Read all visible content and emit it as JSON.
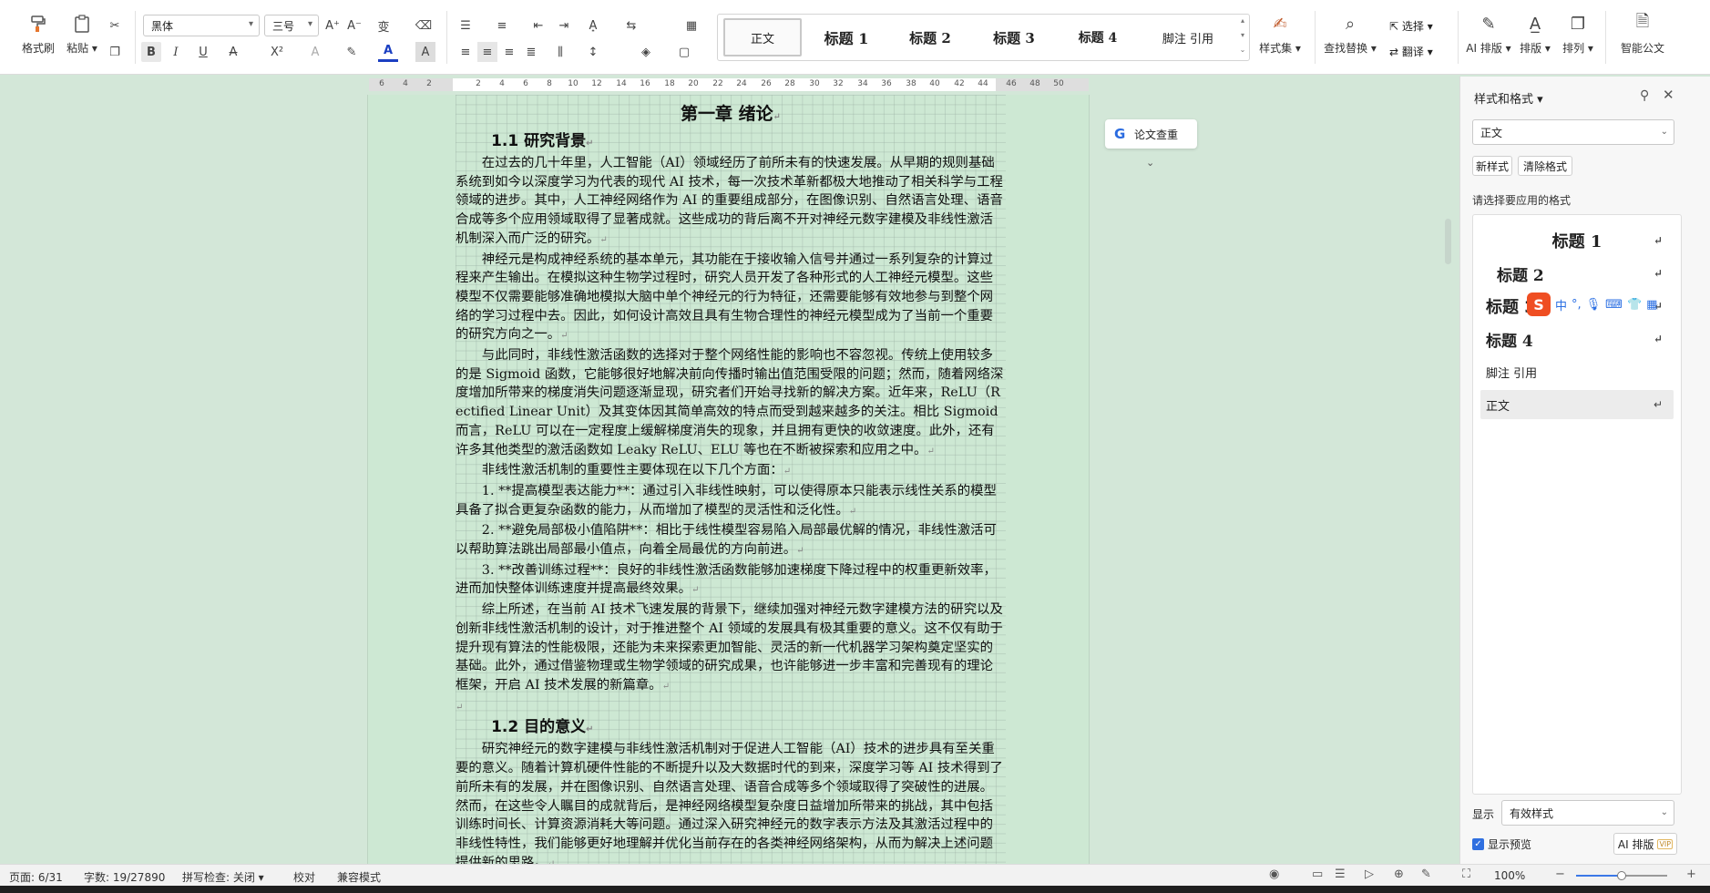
{
  "ribbon": {
    "format_painter": "格式刷",
    "paste": "粘贴",
    "font_name": "黑体",
    "font_size": "三号",
    "styles": [
      "正文",
      "标题 1",
      "标题 2",
      "标题 3",
      "标题 4",
      "脚注 引用"
    ],
    "style_set": "样式集",
    "find_replace": "查找替换",
    "select": "选择",
    "translate": "翻译",
    "ai_layout": "AI 排版",
    "layout": "排版",
    "arrange": "排列",
    "smart_formula": "智能公文"
  },
  "ruler": {
    "ticks": [
      "6",
      "4",
      "2",
      "2",
      "4",
      "6",
      "8",
      "10",
      "12",
      "14",
      "16",
      "18",
      "20",
      "22",
      "24",
      "26",
      "28",
      "30",
      "32",
      "34",
      "36",
      "38",
      "40",
      "42",
      "44",
      "46",
      "48",
      "50"
    ]
  },
  "document": {
    "chapter_title": "第一章 绪论",
    "section1_title": "1.1 研究背景",
    "section1_paragraphs": [
      "在过去的几十年里，人工智能（AI）领域经历了前所未有的快速发展。从早期的规则基础系统到如今以深度学习为代表的现代 AI 技术，每一次技术革新都极大地推动了相关科学与工程领域的进步。其中，人工神经网络作为 AI 的重要组成部分，在图像识别、自然语言处理、语音合成等多个应用领域取得了显著成就。这些成功的背后离不开对神经元数字建模及非线性激活机制深入而广泛的研究。",
      "神经元是构成神经系统的基本单元，其功能在于接收输入信号并通过一系列复杂的计算过程来产生输出。在模拟这种生物学过程时，研究人员开发了各种形式的人工神经元模型。这些模型不仅需要能够准确地模拟大脑中单个神经元的行为特征，还需要能够有效地参与到整个网络的学习过程中去。因此，如何设计高效且具有生物合理性的神经元模型成为了当前一个重要的研究方向之一。",
      "与此同时，非线性激活函数的选择对于整个网络性能的影响也不容忽视。传统上使用较多的是 Sigmoid 函数，它能够很好地解决前向传播时输出值范围受限的问题；然而，随着网络深度增加所带来的梯度消失问题逐渐显现，研究者们开始寻找新的解决方案。近年来，ReLU（Rectified Linear Unit）及其变体因其简单高效的特点而受到越来越多的关注。相比 Sigmoid 而言，ReLU 可以在一定程度上缓解梯度消失的现象，并且拥有更快的收敛速度。此外，还有许多其他类型的激活函数如 Leaky ReLU、ELU 等也在不断被探索和应用之中。",
      "非线性激活机制的重要性主要体现在以下几个方面：",
      "1. **提高模型表达能力**：通过引入非线性映射，可以使得原本只能表示线性关系的模型具备了拟合更复杂函数的能力，从而增加了模型的灵活性和泛化性。",
      "2. **避免局部极小值陷阱**：相比于线性模型容易陷入局部最优解的情况，非线性激活可以帮助算法跳出局部最小值点，向着全局最优的方向前进。",
      "3. **改善训练过程**：良好的非线性激活函数能够加速梯度下降过程中的权重更新效率，进而加快整体训练速度并提高最终效果。",
      "综上所述，在当前 AI 技术飞速发展的背景下，继续加强对神经元数字建模方法的研究以及创新非线性激活机制的设计，对于推进整个 AI 领域的发展具有极其重要的意义。这不仅有助于提升现有算法的性能极限，还能为未来探索更加智能、灵活的新一代机器学习架构奠定坚实的基础。此外，通过借鉴物理或生物学领域的研究成果，也许能够进一步丰富和完善现有的理论框架，开启 AI 技术发展的新篇章。"
    ],
    "section2_title": "1.2 目的意义",
    "section2_paragraphs": [
      "研究神经元的数字建模与非线性激活机制对于促进人工智能（AI）技术的进步具有至关重要的意义。随着计算机硬件性能的不断提升以及大数据时代的到来，深度学习等 AI 技术得到了前所未有的发展，并在图像识别、自然语言处理、语音合成等多个领域取得了突破性的进展。然而，在这些令人瞩目的成就背后，是神经网络模型复杂度日益增加所带来的挑战，其中包括训练时间长、计算资源消耗大等问题。通过深入研究神经元的数字表示方法及其激活过程中的非线性特性，我们能够更好地理解并优化当前存在的各类神经网络架构，从而为解决上述问题提供新的思路。"
    ]
  },
  "floating": {
    "paper_check": "论文查重"
  },
  "panel": {
    "title": "样式和格式",
    "current_style": "正文",
    "new_style_button": "新样式",
    "clear_format_button": "清除格式",
    "apply_label": "请选择要应用的格式",
    "styles": [
      "标题 1",
      "标题 2",
      "标题 3",
      "标题 4",
      "脚注 引用",
      "正文"
    ],
    "display_label": "显示",
    "display_value": "有效样式",
    "preview_label": "显示预览",
    "ai_layout_button": "AI 排版",
    "vip_badge": "VIP",
    "ime_lang": "中"
  },
  "status": {
    "page": "页面: 6/31",
    "words": "字数: 19/27890",
    "spell_check": "拼写检查: 关闭",
    "proofread": "校对",
    "compat_mode": "兼容模式",
    "zoom": "100%",
    "zoom_fraction": 0.5
  }
}
